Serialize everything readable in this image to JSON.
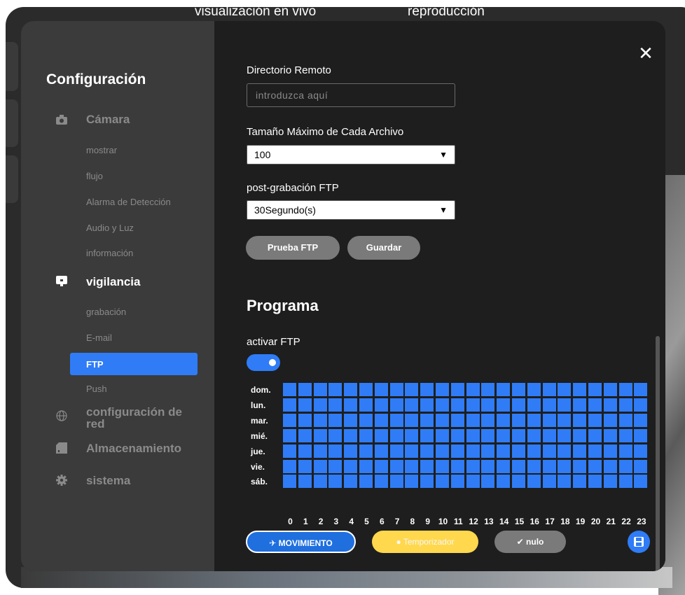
{
  "top_tabs": {
    "live": "visualización en vivo",
    "playback": "reproducción"
  },
  "sidebar": {
    "title": "Configuración",
    "camera": {
      "label": "Cámara",
      "icon": "camera-icon",
      "items": [
        "mostrar",
        "flujo",
        "Alarma de Detección",
        "Audio y Luz",
        "información"
      ]
    },
    "surveillance": {
      "label": "vigilancia",
      "icon": "monitor-icon",
      "items": [
        "grabación",
        "E-mail",
        "FTP",
        "Push"
      ],
      "active": "FTP"
    },
    "network": {
      "label": "configuración de red",
      "icon": "globe-icon"
    },
    "storage": {
      "label": "Almacenamiento",
      "icon": "sd-card-icon"
    },
    "system": {
      "label": "sistema",
      "icon": "gear-icon"
    }
  },
  "content": {
    "remote_dir_label": "Directorio Remoto",
    "remote_dir_placeholder": "introduzca aquí",
    "max_size_label": "Tamaño Máximo de Cada Archivo",
    "max_size_value": "100",
    "post_record_label": "post-grabación FTP",
    "post_record_value": "30Segundo(s)",
    "test_ftp_button": "Prueba FTP",
    "save_button": "Guardar",
    "schedule_title": "Programa",
    "enable_ftp_label": "activar FTP",
    "enable_ftp_on": true,
    "days": [
      "dom.",
      "lun.",
      "mar.",
      "mié.",
      "jue.",
      "vie.",
      "sáb."
    ],
    "hours": [
      "0",
      "1",
      "2",
      "3",
      "4",
      "5",
      "6",
      "7",
      "8",
      "9",
      "10",
      "11",
      "12",
      "13",
      "14",
      "15",
      "16",
      "17",
      "18",
      "19",
      "20",
      "21",
      "22",
      "23"
    ],
    "motion_button": "MOVIMIENTO",
    "timer_button": "Temporizador",
    "none_button": "nulo"
  },
  "colors": {
    "accent": "#2f7cf6",
    "timer": "#ffd84d",
    "sidebar_bg": "#3b3b3b",
    "content_bg": "#1e1e1e"
  }
}
